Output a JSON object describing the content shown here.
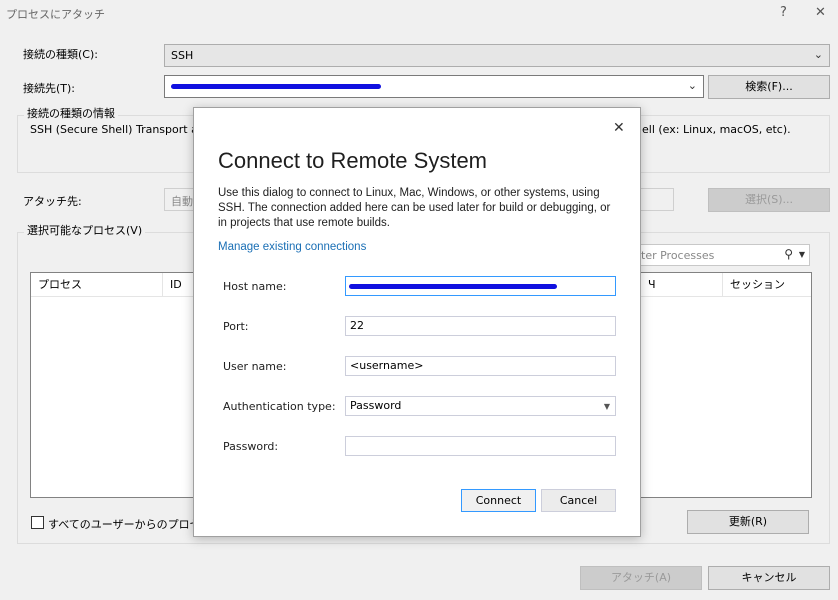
{
  "window": {
    "title": "プロセスにアタッチ",
    "help": "?",
    "close": "✕"
  },
  "main": {
    "connection_type_label": "接続の種類(C):",
    "connection_type_value": "SSH",
    "connection_target_label": "接続先(T):",
    "search_button": "検索(F)...",
    "info_group_label": "接続の種類の情報",
    "info_text_left": "SSH (Secure Shell) Transport all",
    "info_text_right": "ell (ex: Linux, macOS, etc).",
    "attach_to_label": "アタッチ先:",
    "attach_to_value": "自動",
    "select_button": "選択(S)...",
    "available_processes_label": "選択可能なプロセス(V)",
    "filter_placeholder": "ter Processes",
    "columns": [
      "プロセス",
      "ID",
      "Ч",
      "セッション"
    ],
    "show_all_users_label": "すべてのユーザーからのプロセスを",
    "refresh_button": "更新(R)",
    "attach_button": "アタッチ(A)",
    "cancel_button": "キャンセル"
  },
  "dialog": {
    "title": "Connect to Remote System",
    "close": "✕",
    "description": "Use this dialog to connect to Linux, Mac, Windows, or other systems, using SSH. The connection added here can be used later for build or debugging, or in projects that use remote builds.",
    "manage_link": "Manage existing connections",
    "host_label": "Host name:",
    "port_label": "Port:",
    "port_value": "22",
    "user_label": "User name:",
    "user_value": "<username>",
    "auth_label": "Authentication type:",
    "auth_value": "Password",
    "password_label": "Password:",
    "connect_button": "Connect",
    "cancel_button": "Cancel"
  }
}
